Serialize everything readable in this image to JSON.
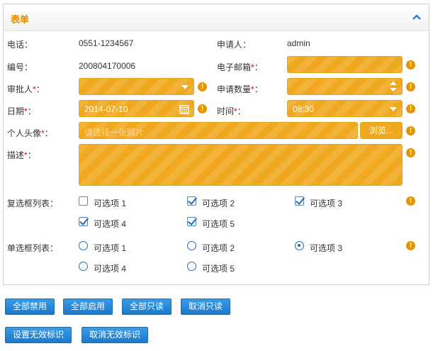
{
  "panel": {
    "title": "表单"
  },
  "labels": {
    "phone": "电话：",
    "applicant": "申请人：",
    "number": "编号：",
    "email": "电子邮箱",
    "approver": "审批人",
    "quantity": "申请数量",
    "date": "日期",
    "time": "时间",
    "avatar": "个人头像",
    "description": "描述",
    "checkbox_list": "复选框列表：",
    "radio_list": "单选框列表：",
    "required_mark": "*",
    "colon": "："
  },
  "values": {
    "phone": "0551-1234567",
    "applicant": "admin",
    "number": "200804170006",
    "date": "2014-07-10",
    "time": "08:30",
    "avatar_placeholder": "请选择一张照片"
  },
  "browse_label": "浏览...",
  "checkboxes": [
    {
      "label": "可选项 1",
      "checked": false
    },
    {
      "label": "可选项 2",
      "checked": true
    },
    {
      "label": "可选项 3",
      "checked": true
    },
    {
      "label": "可选项 4",
      "checked": true
    },
    {
      "label": "可选项 5",
      "checked": true
    }
  ],
  "radios": [
    {
      "label": "可选项 1",
      "checked": false
    },
    {
      "label": "可选项 2",
      "checked": false
    },
    {
      "label": "可选项 3",
      "checked": true
    },
    {
      "label": "可选项 4",
      "checked": false
    },
    {
      "label": "可选项 5",
      "checked": false
    }
  ],
  "buttons": {
    "disable_all": "全部禁用",
    "enable_all": "全部启用",
    "readonly_all": "全部只读",
    "cancel_readonly": "取消只读",
    "set_invalid": "设置无效标识",
    "cancel_invalid": "取消无效标识"
  },
  "colors": {
    "accent": "#f0a81e",
    "title": "#e08a00",
    "button": "#1a78c8",
    "warning": "#e69400"
  }
}
